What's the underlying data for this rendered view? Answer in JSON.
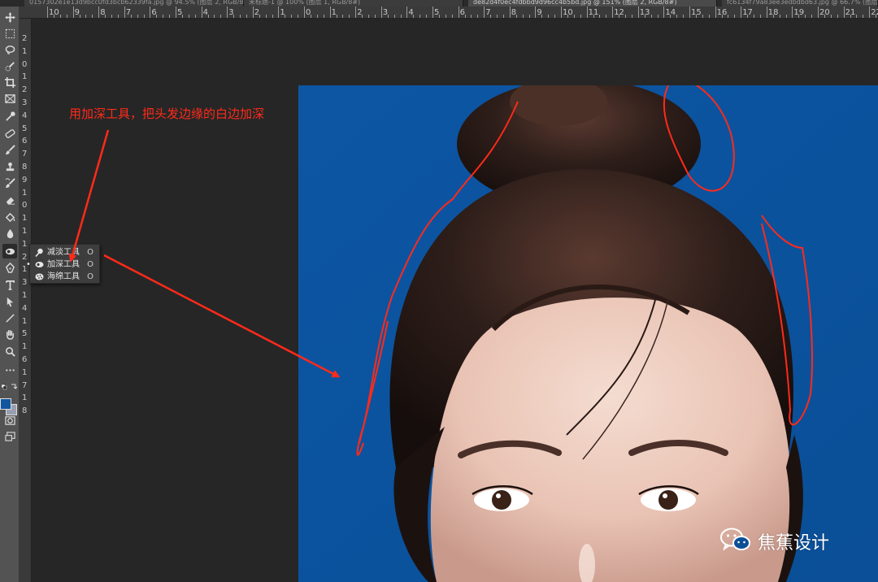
{
  "tabs": [
    {
      "label": "0157302e1e13d9bcc0fd3bcb62339fa.jpg @ 94.5% (图层 2, RGB/8#)"
    },
    {
      "label": "未标题-1 @ 100% (图层 1, RGB/8#)"
    },
    {
      "label": "de82d4f0ec4fdbbd9d96cc4b5bd.jpg @ 151% (图层 2, RGB/8#)"
    },
    {
      "label": "fc6134f79a83ee3edbdbd63.jpg @ 66.7% (图层 1, RGB/8#)"
    }
  ],
  "ruler_top_numbers": [
    "10",
    "9",
    "8",
    "7",
    "6",
    "5",
    "4",
    "3",
    "2",
    "1",
    "0",
    "1",
    "2",
    "3",
    "4",
    "5",
    "6",
    "7",
    "8",
    "9",
    "10",
    "11",
    "12",
    "13",
    "14",
    "15",
    "16",
    "17",
    "18",
    "19",
    "20",
    "21",
    "22"
  ],
  "ruler_left_numbers": [
    "2",
    "1",
    "0",
    "1",
    "2",
    "3",
    "4",
    "5",
    "6",
    "7",
    "8",
    "9",
    "1",
    "0",
    "1",
    "1",
    "1",
    "2",
    "1",
    "3",
    "1",
    "4",
    "1",
    "5",
    "1",
    "6",
    "1",
    "7",
    "1",
    "8"
  ],
  "flyout": {
    "items": [
      {
        "label": "减淡工具",
        "shortcut": "O",
        "icon": "dodge-icon",
        "active": false
      },
      {
        "label": "加深工具",
        "shortcut": "O",
        "icon": "burn-icon",
        "active": true
      },
      {
        "label": "海绵工具",
        "shortcut": "O",
        "icon": "sponge-icon",
        "active": false
      }
    ]
  },
  "annotation": {
    "text": "用加深工具，把头发边缘的白边加深",
    "color": "#ff2a1a"
  },
  "colors": {
    "foreground": "#1155a0",
    "background": "#9a9fb0",
    "photo_bg": "#0d56a2"
  },
  "watermark": {
    "text": "焦蕉设计",
    "icon": "wechat-icon"
  },
  "tools": [
    "move-icon",
    "marquee-icon",
    "lasso-icon",
    "quick-select-icon",
    "crop-icon",
    "frame-icon",
    "eyedropper-icon",
    "healing-brush-icon",
    "brush-icon",
    "clone-stamp-icon",
    "history-brush-icon",
    "eraser-icon",
    "paint-bucket-icon",
    "blur-icon",
    "burn-tool-icon",
    "pen-icon",
    "type-icon",
    "path-select-icon",
    "line-icon",
    "hand-icon",
    "zoom-icon",
    "more-tools-icon"
  ]
}
